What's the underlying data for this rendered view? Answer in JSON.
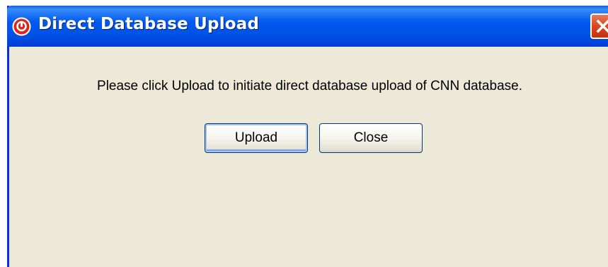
{
  "window": {
    "title": "Direct Database Upload",
    "app_icon": "app-logo-icon",
    "close_icon": "close-icon"
  },
  "dialog": {
    "message": "Please click Upload to initiate direct database upload of CNN database.",
    "buttons": {
      "upload_label": "Upload",
      "close_label": "Close"
    }
  },
  "colors": {
    "titlebar": "#0058ee",
    "window_bg": "#ece9d8",
    "close_button": "#d9461f",
    "app_icon": "#d8291c"
  }
}
